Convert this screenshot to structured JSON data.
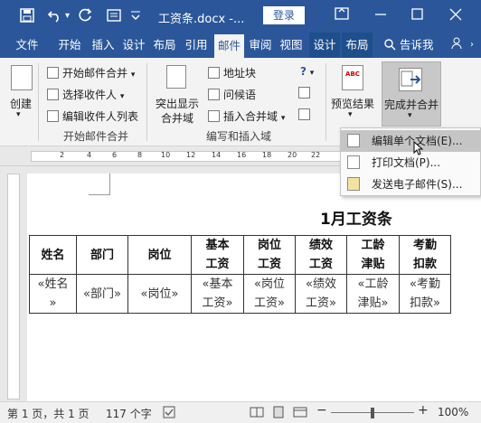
{
  "titlebar": {
    "doc_title": "工资条.docx -...",
    "login": "登录",
    "save_icon": "save-icon",
    "undo_icon": "undo-icon",
    "redo_icon": "redo-icon"
  },
  "tabs": [
    "文件",
    "开始",
    "插入",
    "设计",
    "布局",
    "引用",
    "邮件",
    "审阅",
    "视图",
    "设计",
    "布局"
  ],
  "tell_me": "告诉我",
  "ribbon": {
    "create": "创建",
    "start_merge": "开始邮件合并",
    "select_recipients": "选择收件人",
    "edit_recipients": "编辑收件人列表",
    "group_start": "开始邮件合并",
    "highlight_line1": "突出显示",
    "highlight_line2": "合并域",
    "address_block": "地址块",
    "greeting_line": "问候语",
    "insert_merge_field": "插入合并域",
    "group_write": "编写和插入域",
    "preview_results": "预览结果",
    "abc": "ABC",
    "finish_merge": "完成并合并"
  },
  "dropdown": {
    "items": [
      "编辑单个文档(E)...",
      "打印文档(P)...",
      "发送电子邮件(S)..."
    ]
  },
  "ruler": {
    "numbers": [
      "2",
      "4",
      "6",
      "8",
      "10",
      "12",
      "14",
      "16",
      "18",
      "20",
      "22"
    ]
  },
  "document": {
    "heading": "1月工资条",
    "headers": [
      "姓名",
      "部门",
      "岗位",
      "基本\n工资",
      "岗位\n工资",
      "绩效\n工资",
      "工龄\n津贴",
      "考勤\n扣款"
    ],
    "fields": [
      "«姓名\n»",
      "«部门»",
      "«岗位»",
      "«基本\n工资»",
      "«岗位\n工资»",
      "«绩效\n工资»",
      "«工龄\n津贴»",
      "«考勤\n扣款»"
    ]
  },
  "statusbar": {
    "page": "第 1 页，共 1 页",
    "words": "117 个字",
    "zoom": "100%"
  }
}
